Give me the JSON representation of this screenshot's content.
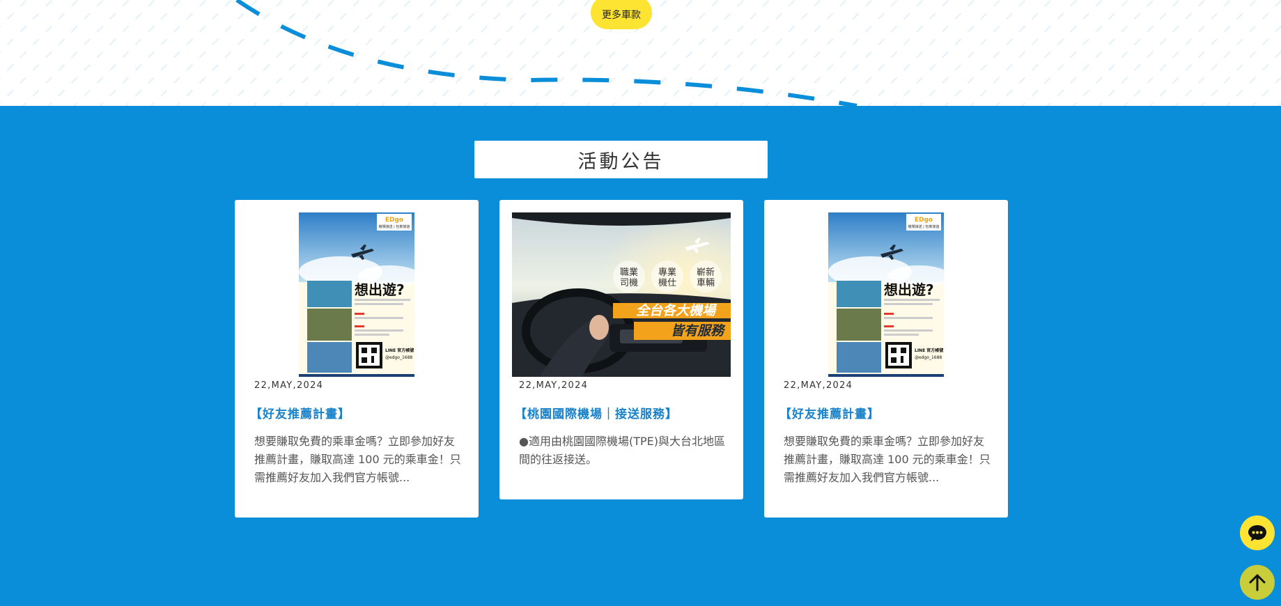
{
  "hero": {
    "more_cars_label": "更多車款"
  },
  "section": {
    "title": "活動公告"
  },
  "cards": [
    {
      "image_alt": "好友推薦計畫 poster",
      "poster": {
        "brand": "EDgo",
        "brand_sub": "機場接送 | 包車旅遊",
        "headline": "想出遊?",
        "line_label": "LINE 官方帳號",
        "line_id": "@edgo_1688"
      },
      "date": "22,MAY,2024",
      "title": "【好友推薦計畫】",
      "desc": "想要賺取免費的乘車金嗎？立即參加好友推薦計畫，賺取高達 100 元的乘車金！只需推薦好友加入我們官方帳號..."
    },
    {
      "image_alt": "機場接送 banner",
      "banner": {
        "badge1": "職業司機",
        "badge2": "專業機仕",
        "badge3": "嶄新車輛",
        "line1": "全台各大機場",
        "line2": "皆有服務"
      },
      "date": "22,MAY,2024",
      "title": "【桃園國際機場｜接送服務】",
      "desc": "●適用由桃園國際機場(TPE)與大台北地區間的往返接送。"
    },
    {
      "image_alt": "好友推薦計畫 poster",
      "poster": {
        "brand": "EDgo",
        "brand_sub": "機場接送 | 包車旅遊",
        "headline": "想出遊?",
        "line_label": "LINE 官方帳號",
        "line_id": "@edgo_1688"
      },
      "date": "22,MAY,2024",
      "title": "【好友推薦計畫】",
      "desc": "想要賺取免費的乘車金嗎？立即參加好友推薦計畫，賺取高達 100 元的乘車金！只需推薦好友加入我們官方帳號..."
    }
  ],
  "floating": {
    "chat_icon": "chat-bubble-icon",
    "top_icon": "arrow-up-icon"
  },
  "colors": {
    "section_bg": "#0a8ed9",
    "accent_yellow": "#fde432",
    "title_blue": "#1a82c9",
    "dash_blue": "#0a8ed9"
  }
}
